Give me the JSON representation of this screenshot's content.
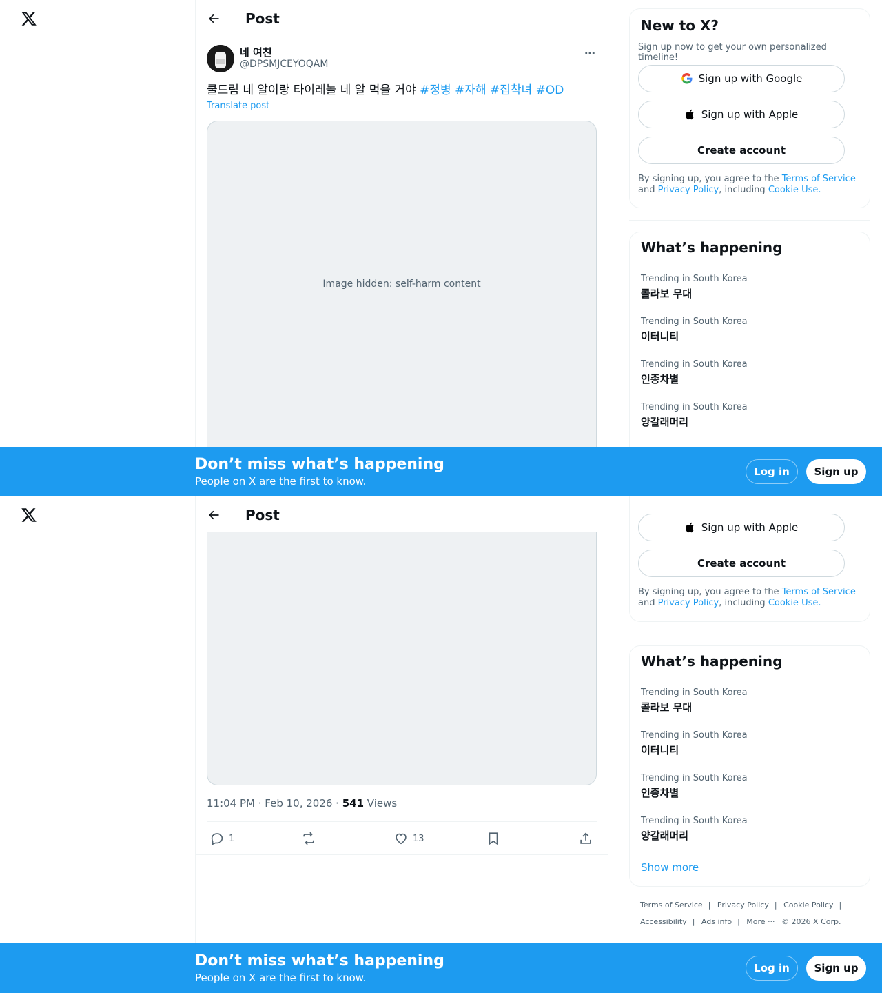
{
  "header": {
    "title": "Post"
  },
  "post": {
    "author_name": "네 여친",
    "author_handle": "@DPSMJCEYOQAM",
    "text": "쿨드림 네 알이랑 타이레놀 네 알 먹을 거야",
    "hashtags": [
      "#정병",
      "#자해",
      "#집착녀",
      "#OD"
    ],
    "translate_label": "Translate post",
    "media_notice": "Image hidden: self-harm content",
    "time": "11:04 PM · Feb 10, 2026 · ",
    "views_count": "541",
    "views_label": " Views",
    "replies": "1",
    "likes": "13"
  },
  "signup_card": {
    "title": "New to X?",
    "subtitle": "Sign up now to get your own personalized timeline!",
    "google_label": "Sign up with Google",
    "apple_label": "Sign up with Apple",
    "create_label": "Create account",
    "terms_prefix": "By signing up, you agree to the ",
    "terms_link": "Terms of Service",
    "terms_and": " and ",
    "privacy_link": "Privacy Policy",
    "terms_including": ", including ",
    "cookie_link": "Cookie Use."
  },
  "trends": {
    "title": "What’s happening",
    "items": [
      {
        "context": "Trending in South Korea",
        "name": "콜라보 무대"
      },
      {
        "context": "Trending in South Korea",
        "name": "이터니티"
      },
      {
        "context": "Trending in South Korea",
        "name": "인종차별"
      },
      {
        "context": "Trending in South Korea",
        "name": "양갈래머리"
      }
    ],
    "show_more": "Show more"
  },
  "footer": {
    "links": [
      "Terms of Service",
      "Privacy Policy",
      "Cookie Policy",
      "Accessibility",
      "Ads info",
      "More ···"
    ],
    "copyright": "© 2026 X Corp."
  },
  "banner": {
    "headline": "Don’t miss what’s happening",
    "subtext": "People on X are the first to know.",
    "login": "Log in",
    "signup": "Sign up"
  }
}
